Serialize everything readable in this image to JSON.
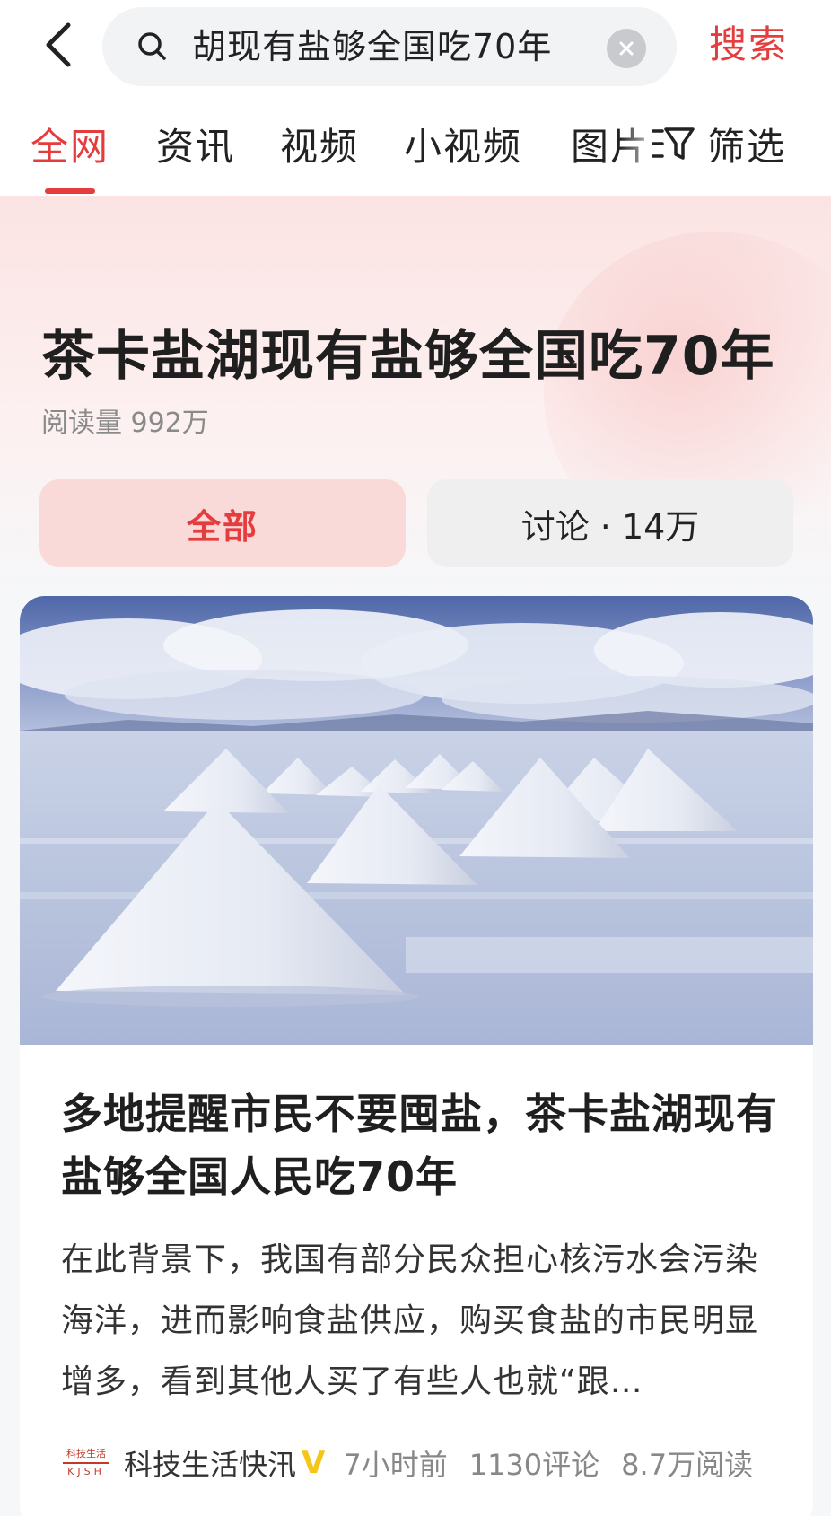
{
  "header": {
    "search_query": "胡现有盐够全国吃70年",
    "search_button": "搜索"
  },
  "tabs": {
    "items": [
      "全网",
      "资讯",
      "视频",
      "小视频",
      "图片"
    ],
    "active_index": 0,
    "filter_label": "筛选"
  },
  "topic": {
    "title": "茶卡盐湖现有盐够全国吃70年",
    "reads": "阅读量 992万",
    "segment_all": "全部",
    "segment_discuss": "讨论 · 14万"
  },
  "article": {
    "title": "多地提醒市民不要囤盐，茶卡盐湖现有盐够全国人民吃70年",
    "summary": "在此背景下，我国有部分民众担心核污水会污染海洋，进而影响食盐供应，购买食盐的市民明显增多，看到其他人买了有些人也就“跟…",
    "source_logo_cn": "科技生活",
    "source_logo_en": "KJSH",
    "source": "科技生活快汛",
    "verified_mark": "V",
    "time": "7小时前",
    "comments": "1130评论",
    "reads": "8.7万阅读"
  },
  "colors": {
    "accent": "#e53d3d",
    "verified": "#f5c518"
  },
  "icons": {
    "back": "chevron-left-icon",
    "search": "search-icon",
    "clear": "close-circle-icon",
    "filter": "filter-icon"
  }
}
